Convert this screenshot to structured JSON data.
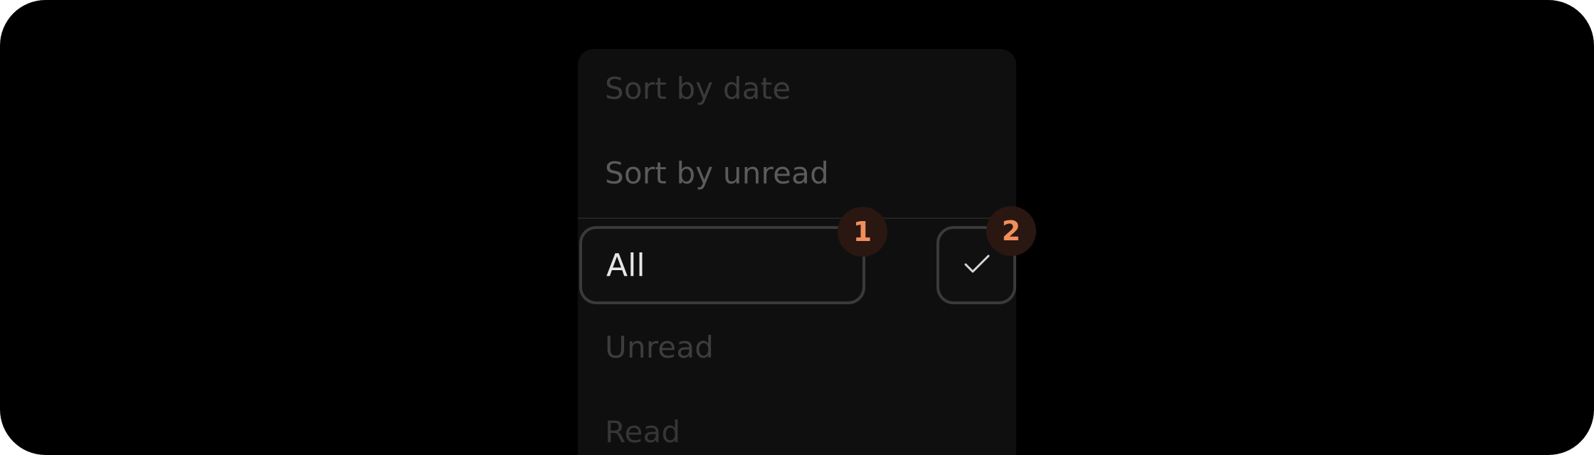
{
  "menu": {
    "sort_options": [
      {
        "label": "Sort by date"
      },
      {
        "label": "Sort by unread"
      }
    ],
    "filter_options": [
      {
        "label": "All",
        "selected": true
      },
      {
        "label": "Unread",
        "selected": false
      },
      {
        "label": "Read",
        "selected": false
      }
    ]
  },
  "annotations": {
    "badge_1": "1",
    "badge_2": "2"
  },
  "icons": {
    "selected_indicator": "checkmark-icon"
  },
  "colors": {
    "background": "#000000",
    "menu_surface": "#0f0f0f",
    "badge_text": "#f08f5c",
    "badge_fill": "#2a1712",
    "focus_border": "#3a3a3a"
  }
}
